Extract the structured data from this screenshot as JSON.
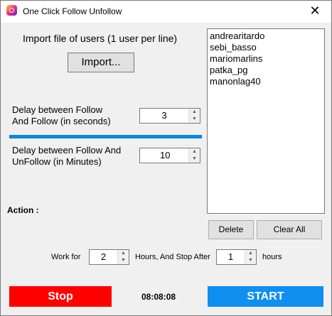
{
  "window": {
    "title": "One Click Follow Unfollow",
    "close_glyph": "✕"
  },
  "import": {
    "label": "Import file of users (1 user per line)",
    "button": "Import..."
  },
  "delay_follow": {
    "label_line1": "Delay between Follow",
    "label_line2": "And Follow (in seconds)",
    "value": "3"
  },
  "delay_unfollow": {
    "label_line1": "Delay between Follow And",
    "label_line2": "UnFollow (in Minutes)",
    "value": "10"
  },
  "action_label": "Action :",
  "users": [
    "andrearitardo",
    "sebi_basso",
    "mariomarlins",
    "patka_pg",
    "manonlag40"
  ],
  "list_buttons": {
    "delete": "Delete",
    "clear_all": "Clear All"
  },
  "schedule": {
    "work_for": "Work for",
    "hours_value": "2",
    "hours_stop_after": "Hours,  And Stop After",
    "stop_value": "1",
    "hours": "hours"
  },
  "footer": {
    "stop": "Stop",
    "timer": "08:08:08",
    "start": "START"
  },
  "colors": {
    "stop": "#ff0000",
    "start": "#0f8ff0",
    "divider": "#0b85e3"
  },
  "icons": {
    "spin_up": "▲",
    "spin_down": "▼"
  }
}
